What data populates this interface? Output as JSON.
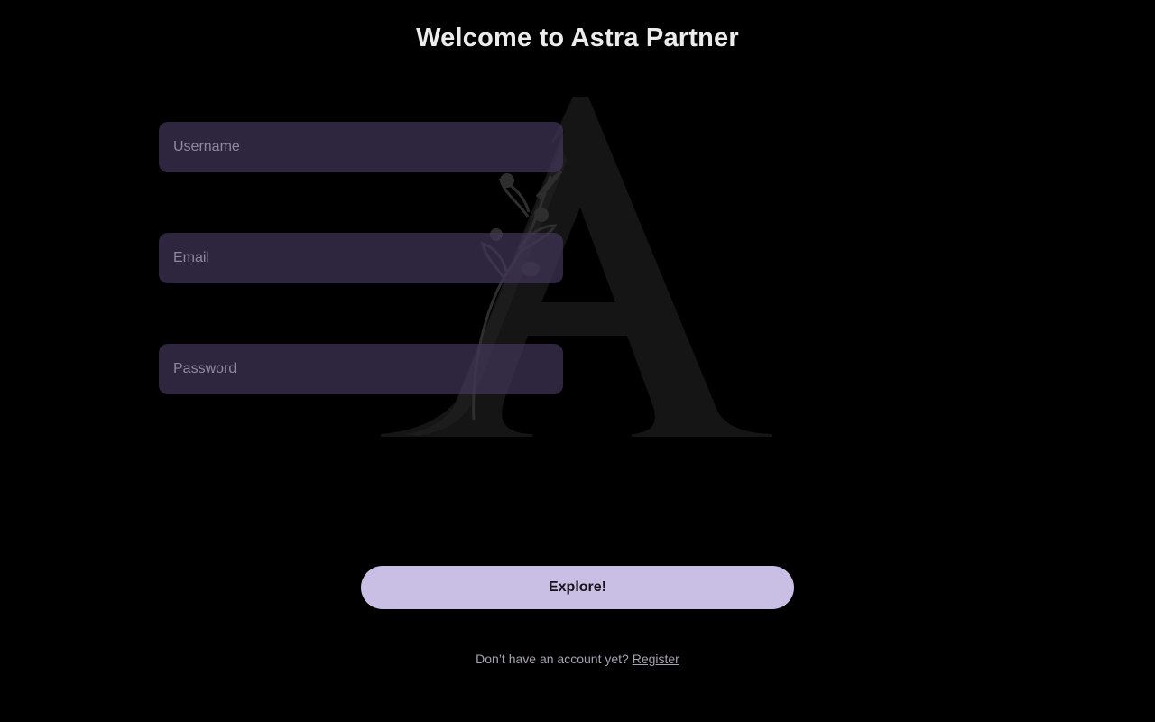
{
  "header": {
    "title": "Welcome to Astra Partner"
  },
  "logo": {
    "icon": "astra-a-leaf-logo-icon",
    "letter_color": "#161616",
    "leaf_color": "#2a2a2a"
  },
  "form": {
    "username_placeholder": "Username",
    "email_placeholder": "Email",
    "password_placeholder": "Password",
    "username_value": "",
    "email_value": "",
    "password_value": ""
  },
  "actions": {
    "explore_label": "Explore!"
  },
  "footer": {
    "prompt_text": "Don’t have an account yet?",
    "register_label": "Register"
  },
  "colors": {
    "background": "#000000",
    "field_background": "#332a42",
    "button_background": "#c9bfe5",
    "title_color": "#ececec"
  }
}
